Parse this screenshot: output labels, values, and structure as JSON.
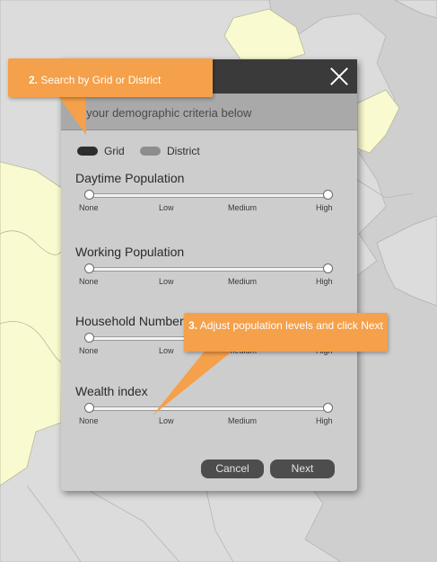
{
  "dialog": {
    "subheader_text": "er your demographic criteria below",
    "close_label": "Close",
    "toggles": [
      {
        "label": "Grid",
        "state": "on"
      },
      {
        "label": "District",
        "state": "off"
      }
    ],
    "sliders": [
      {
        "title": "Daytime Population",
        "ticks": [
          "None",
          "Low",
          "Medium",
          "High"
        ],
        "range_min": 0,
        "range_max": 1
      },
      {
        "title": "Working Population",
        "ticks": [
          "None",
          "Low",
          "Medium",
          "High"
        ],
        "range_min": 0,
        "range_max": 1
      },
      {
        "title": "Household Number",
        "ticks": [
          "None",
          "Low",
          "Medium",
          "High"
        ],
        "range_min": 0,
        "range_max": 1
      },
      {
        "title": "Wealth index",
        "ticks": [
          "None",
          "Low",
          "Medium",
          "High"
        ],
        "range_min": 0,
        "range_max": 1
      }
    ],
    "buttons": {
      "cancel": "Cancel",
      "next": "Next"
    }
  },
  "callouts": [
    {
      "number": "2.",
      "text": "Search by Grid or District"
    },
    {
      "number": "3.",
      "text": "Adjust population levels and click Next"
    }
  ],
  "colors": {
    "callout": "#f5a04a",
    "map_land_highlight": "#fafad0",
    "map_land": "#d9d9d9",
    "map_sea": "#cfcfcf",
    "dialog_header": "#3a3a3a"
  }
}
